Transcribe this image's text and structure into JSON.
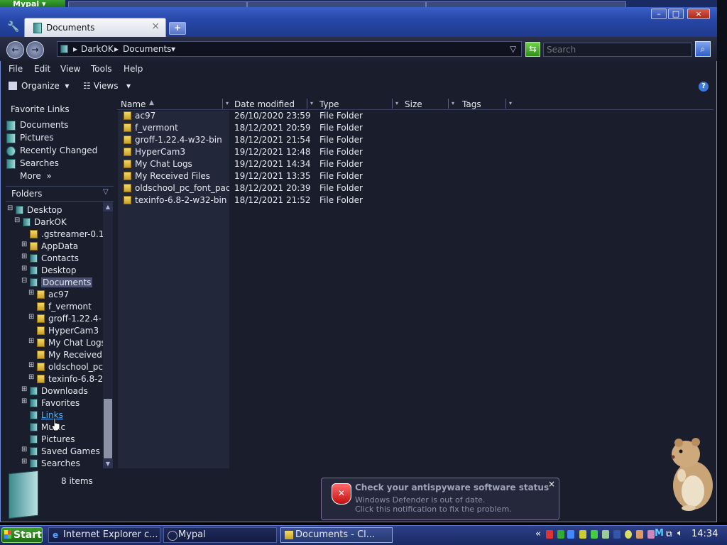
{
  "outer": {
    "app_tab": "Mypal"
  },
  "window": {
    "tab_title": "Documents",
    "tab_close": "×",
    "new_tab": "+",
    "controls": {
      "minimize": "–",
      "maximize": "□",
      "close": "×"
    }
  },
  "address": {
    "crumbs": [
      "DarkOK",
      "Documents"
    ],
    "search_placeholder": "Search"
  },
  "menu": [
    "File",
    "Edit",
    "View",
    "Tools",
    "Help"
  ],
  "toolbar": {
    "organize": "Organize",
    "views": "Views",
    "help_icon": "?"
  },
  "favorites": {
    "heading": "Favorite Links",
    "items": [
      "Documents",
      "Pictures",
      "Recently Changed",
      "Searches"
    ],
    "more": "More"
  },
  "folders": {
    "heading": "Folders",
    "tree": [
      {
        "label": "Desktop",
        "expander": "⊟"
      },
      {
        "label": "DarkOK",
        "expander": "⊟"
      },
      {
        "label": ".gstreamer-0.1",
        "expander": ""
      },
      {
        "label": "AppData",
        "expander": "⊞"
      },
      {
        "label": "Contacts",
        "expander": "⊞"
      },
      {
        "label": "Desktop",
        "expander": "⊞"
      },
      {
        "label": "Documents",
        "expander": "⊟",
        "selected": true
      },
      {
        "label": "ac97",
        "expander": "⊞"
      },
      {
        "label": "f_vermont",
        "expander": ""
      },
      {
        "label": "groff-1.22.4-",
        "expander": "⊞"
      },
      {
        "label": "HyperCam3",
        "expander": ""
      },
      {
        "label": "My Chat Logs",
        "expander": "⊞"
      },
      {
        "label": "My Received",
        "expander": ""
      },
      {
        "label": "oldschool_pc_",
        "expander": "⊞"
      },
      {
        "label": "texinfo-6.8-2",
        "expander": "⊞"
      },
      {
        "label": "Downloads",
        "expander": "⊞"
      },
      {
        "label": "Favorites",
        "expander": "⊞"
      },
      {
        "label": "Links",
        "expander": "",
        "hover": true
      },
      {
        "label": "Music",
        "expander": ""
      },
      {
        "label": "Pictures",
        "expander": ""
      },
      {
        "label": "Saved Games",
        "expander": "⊞"
      },
      {
        "label": "Searches",
        "expander": "⊞"
      }
    ]
  },
  "columns": [
    "Name",
    "Date modified",
    "Type",
    "Size",
    "Tags"
  ],
  "files": [
    {
      "name": "ac97",
      "date": "26/10/2020 23:59",
      "type": "File Folder"
    },
    {
      "name": "f_vermont",
      "date": "18/12/2021 20:59",
      "type": "File Folder"
    },
    {
      "name": "groff-1.22.4-w32-bin",
      "date": "18/12/2021 21:54",
      "type": "File Folder"
    },
    {
      "name": "HyperCam3",
      "date": "19/12/2021 12:48",
      "type": "File Folder"
    },
    {
      "name": "My Chat Logs",
      "date": "19/12/2021 14:34",
      "type": "File Folder"
    },
    {
      "name": "My Received Files",
      "date": "19/12/2021 13:35",
      "type": "File Folder"
    },
    {
      "name": "oldschool_pc_font_pac...",
      "date": "18/12/2021 20:39",
      "type": "File Folder"
    },
    {
      "name": "texinfo-6.8-2-w32-bin",
      "date": "18/12/2021 21:52",
      "type": "File Folder"
    }
  ],
  "status": {
    "count": "8 items"
  },
  "notification": {
    "title": "Check your antispyware software status",
    "line1": "Windows Defender is out of date.",
    "line2": "Click this notification to fix the problem.",
    "close": "×"
  },
  "taskbar": {
    "start": "Start",
    "tasks": [
      "Internet Explorer c...",
      "Mypal",
      "Documents - Cl..."
    ],
    "clock": "14:34",
    "tray_chevron": "«"
  },
  "colors": {
    "window_bg": "#1a1d2b",
    "titlebar": "#2746a6",
    "taskbar": "#1a2a66",
    "start": "#3f9c2c",
    "folder_icon": "#e8c84a",
    "link_hover": "#4fb3ff",
    "selected_bg": "#4a5170"
  }
}
